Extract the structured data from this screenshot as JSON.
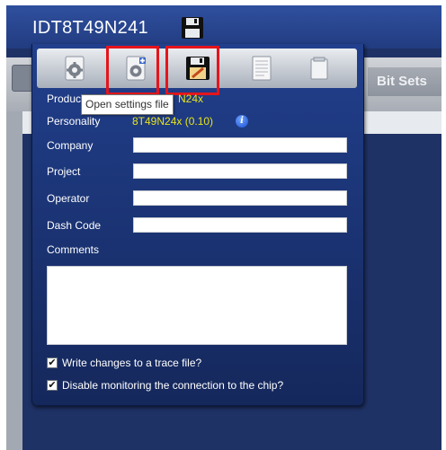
{
  "window": {
    "title": "IDT8T49N241"
  },
  "background": {
    "tab_bitsets": "Bit Sets"
  },
  "toolbar": {
    "buttons": [
      {
        "name": "settings-icon"
      },
      {
        "name": "open-settings-file-icon"
      },
      {
        "name": "save-settings-icon"
      },
      {
        "name": "text-document-icon"
      },
      {
        "name": "blank-document-icon"
      }
    ],
    "tooltip": "Open settings file",
    "highlight_color": "#e5141c"
  },
  "form": {
    "product_label": "Produc",
    "product_value": "N24x",
    "personality_label": "Personality",
    "personality_value": "8T49N24x (0.10)",
    "company_label": "Company",
    "project_label": "Project",
    "operator_label": "Operator",
    "dash_code_label": "Dash Code",
    "comments_label": "Comments",
    "company_value": "",
    "project_value": "",
    "operator_value": "",
    "dash_code_value": "",
    "comments_value": ""
  },
  "options": {
    "trace_label": "Write changes to a trace file?",
    "trace_checked": true,
    "monitor_label": "Disable monitoring the connection to the chip?",
    "monitor_checked": true
  },
  "colors": {
    "accent_yellow": "#e6e31a",
    "panel_blue": "#1c3577"
  }
}
